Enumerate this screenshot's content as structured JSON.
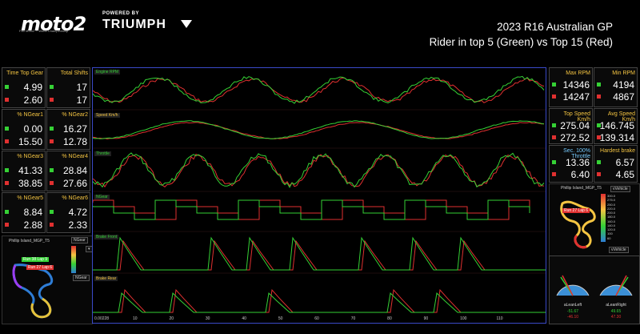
{
  "branding": {
    "moto2_text": "moto2",
    "moto2_sub": "FIM Moto2™ World Championship",
    "powered_by": "POWERED BY",
    "triumph": "TRIUMPH"
  },
  "title": {
    "line1": "2023 R16 Australian GP",
    "line2": "Rider in top 5 (Green) vs Top 15 (Red)"
  },
  "colors": {
    "green": "#35d135",
    "red": "#e03030",
    "accent_blue": "#3a4ac8",
    "label_yellow": "#f5c542"
  },
  "left_stats": [
    {
      "label": "Time Top Gear",
      "green": "4.99",
      "red": "2.60"
    },
    {
      "label": "Total Shifts",
      "green": "17",
      "red": "17"
    },
    {
      "label": "% NGear1",
      "green": "0.00",
      "red": "15.50"
    },
    {
      "label": "% NGear2",
      "green": "16.27",
      "red": "12.78"
    },
    {
      "label": "% NGear3",
      "green": "41.33",
      "red": "38.85"
    },
    {
      "label": "% NGear4",
      "green": "28.84",
      "red": "27.66"
    },
    {
      "label": "% NGear5",
      "green": "8.84",
      "red": "2.88"
    },
    {
      "label": "% NGear6",
      "green": "4.72",
      "red": "2.33"
    }
  ],
  "right_stats": [
    {
      "label": "Max RPM",
      "green": "14346",
      "red": "14247"
    },
    {
      "label": "Min RPM",
      "green": "4194",
      "red": "4867"
    },
    {
      "label": "Top Speed Km/h",
      "green": "275.04",
      "red": "272.52"
    },
    {
      "label": "Avg Speed Km/h",
      "green": "146.745",
      "red": "139.314"
    },
    {
      "label": "Sec. 100% Throttle",
      "green": "13.36",
      "red": "6.40"
    },
    {
      "label": "Hardest brake",
      "green": "6.57",
      "red": "4.65"
    }
  ],
  "chart": {
    "tags": [
      "Engine RPM",
      "Speed Km/h",
      "Throttle",
      "NGear",
      "Brake Front",
      "Brake Rear"
    ],
    "x_axis_start": "0.00228",
    "x_ticks": [
      "10",
      "20",
      "30",
      "40",
      "50",
      "60",
      "70",
      "80",
      "90",
      "100",
      "110"
    ]
  },
  "left_map": {
    "title": "Phillip Island_MGP_T5",
    "gear_btn": "NGear",
    "run_green": "Run 38 Lap 9",
    "run_red": "Run 27 Lap 6"
  },
  "right_map": {
    "title": "Phillip Island_MGP_T5",
    "vbtn": "vVehicle",
    "vbtn2": "vVehicle",
    "run_red": "Run 27 Lap 6",
    "scale": [
      "300.0",
      "275.0",
      "250.0",
      "220.0",
      "200.0",
      "180.0",
      "160.0",
      "140.0",
      "120.0",
      "100",
      "60"
    ]
  },
  "gauges": {
    "left_label": "aLeanLeft",
    "right_label": "aLeanRight",
    "left_green": "-51.67",
    "left_red": "-46.10",
    "right_green": "49.65",
    "right_red": "47.30"
  }
}
